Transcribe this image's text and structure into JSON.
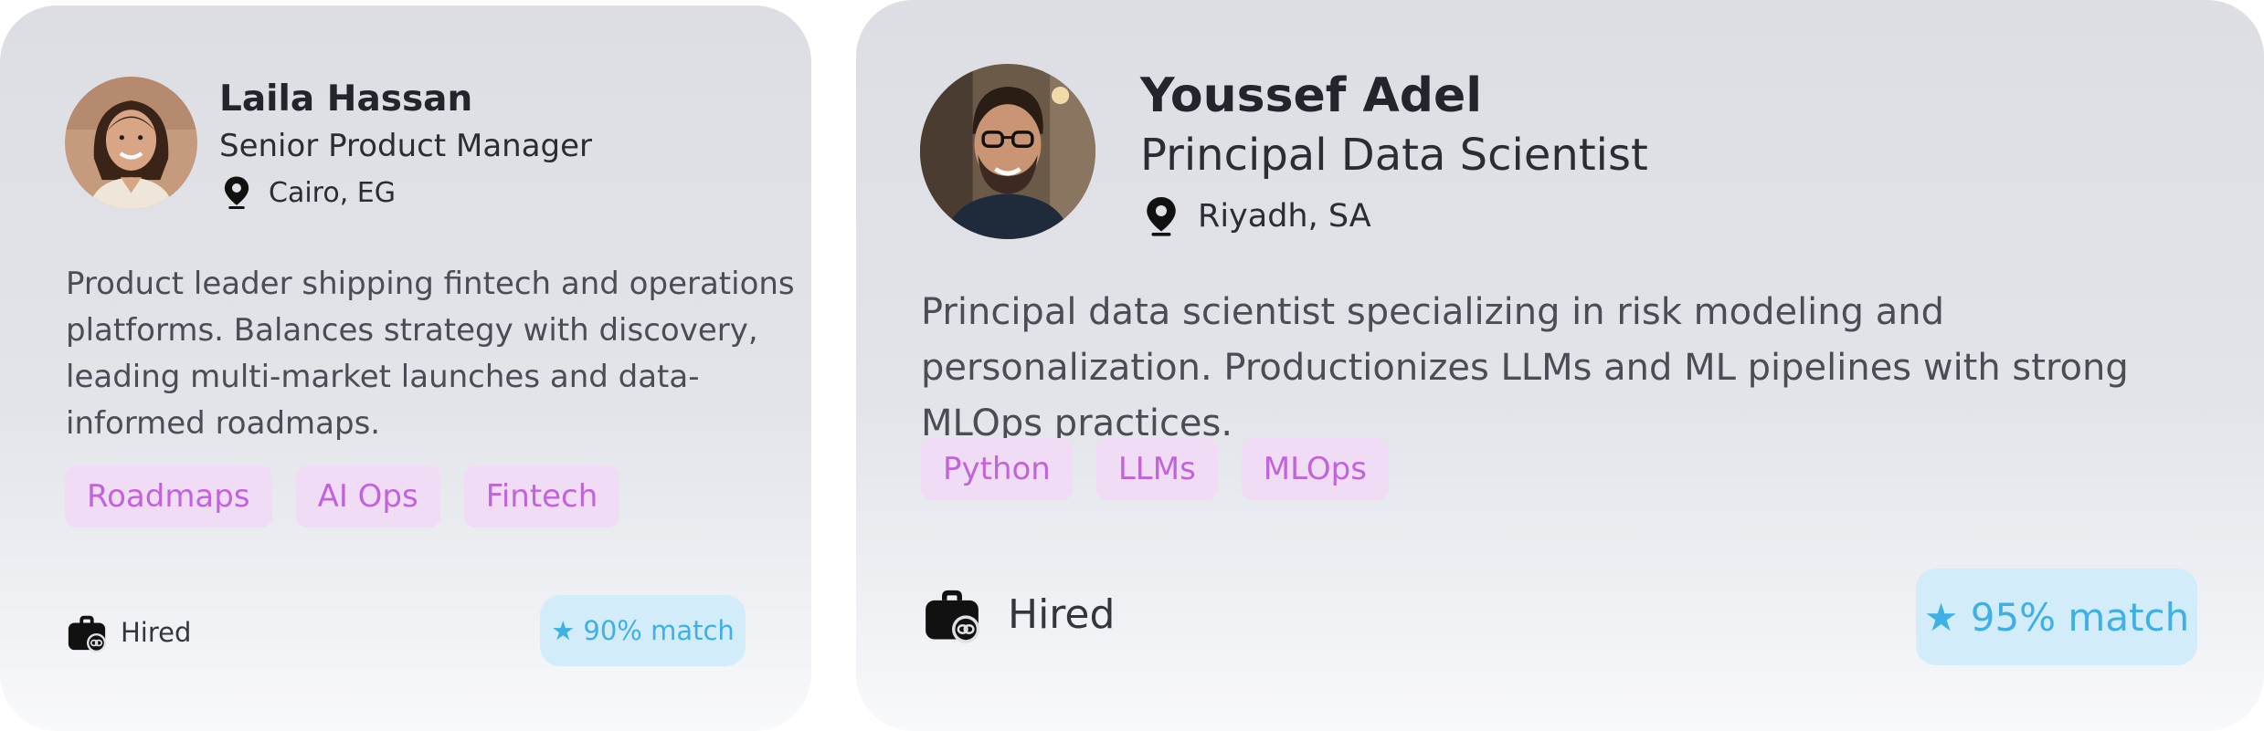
{
  "candidates": [
    {
      "name": "Laila Hassan",
      "title": "Senior Product Manager",
      "location": "Cairo, EG",
      "location_icon": "map-pin-icon",
      "bio": "Product leader shipping fintech and operations platforms. Balances strategy with discovery, leading multi-market launches and data-informed roadmaps.",
      "tags": [
        "Roadmaps",
        "AI Ops",
        "Fintech"
      ],
      "status": "Hired",
      "status_icon": "briefcase-link-icon",
      "match": "★ 90% match"
    },
    {
      "name": "Youssef Adel",
      "title": "Principal Data Scientist",
      "location": "Riyadh, SA",
      "location_icon": "map-pin-icon",
      "bio": "Principal data scientist specializing in risk modeling and personalization. Productionizes LLMs and ML pipelines with strong MLOps practices.",
      "tags": [
        "Python",
        "LLMs",
        "MLOps"
      ],
      "status": "Hired",
      "status_icon": "briefcase-link-icon",
      "match": "★ 95% match"
    }
  ],
  "colors": {
    "tag_bg": "#f1dcf5",
    "tag_text": "#c163dc",
    "match_bg": "#d2ecf9",
    "match_text": "#3fb0e6"
  }
}
